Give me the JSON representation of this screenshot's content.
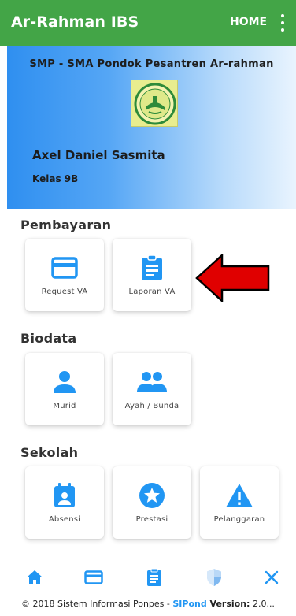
{
  "appbar": {
    "title": "Ar-Rahman IBS",
    "home_label": "HOME",
    "menu_icon": "more-vert-icon"
  },
  "profile": {
    "school": "SMP - SMA Pondok Pesantren Ar-rahman",
    "student_name": "Axel Daniel Sasmita",
    "class": "Kelas 9B"
  },
  "sections": {
    "pembayaran": "Pembayaran",
    "biodata": "Biodata",
    "sekolah": "Sekolah"
  },
  "tiles": {
    "request_va": {
      "label": "Request VA",
      "icon": "credit-card-icon"
    },
    "laporan_va": {
      "label": "Laporan VA",
      "icon": "clipboard-icon"
    },
    "murid": {
      "label": "Murid",
      "icon": "person-icon"
    },
    "ayah_bunda": {
      "label": "Ayah / Bunda",
      "icon": "people-icon"
    },
    "absensi": {
      "label": "Absensi",
      "icon": "calendar-person-icon"
    },
    "prestasi": {
      "label": "Prestasi",
      "icon": "star-icon"
    },
    "pelanggaran": {
      "label": "Pelanggaran",
      "icon": "warning-icon"
    }
  },
  "bottom_nav": [
    "home-icon",
    "credit-card-icon",
    "clipboard-icon",
    "shield-icon",
    "close-icon"
  ],
  "footer": {
    "prefix": "© 2018 Sistem Informasi Ponpes - ",
    "brand": "SIPond",
    "version_label": " Version:",
    "version": " 2.0..."
  },
  "colors": {
    "appbar": "#43a547",
    "accent": "#2196f3",
    "arrow": "#e00000"
  }
}
